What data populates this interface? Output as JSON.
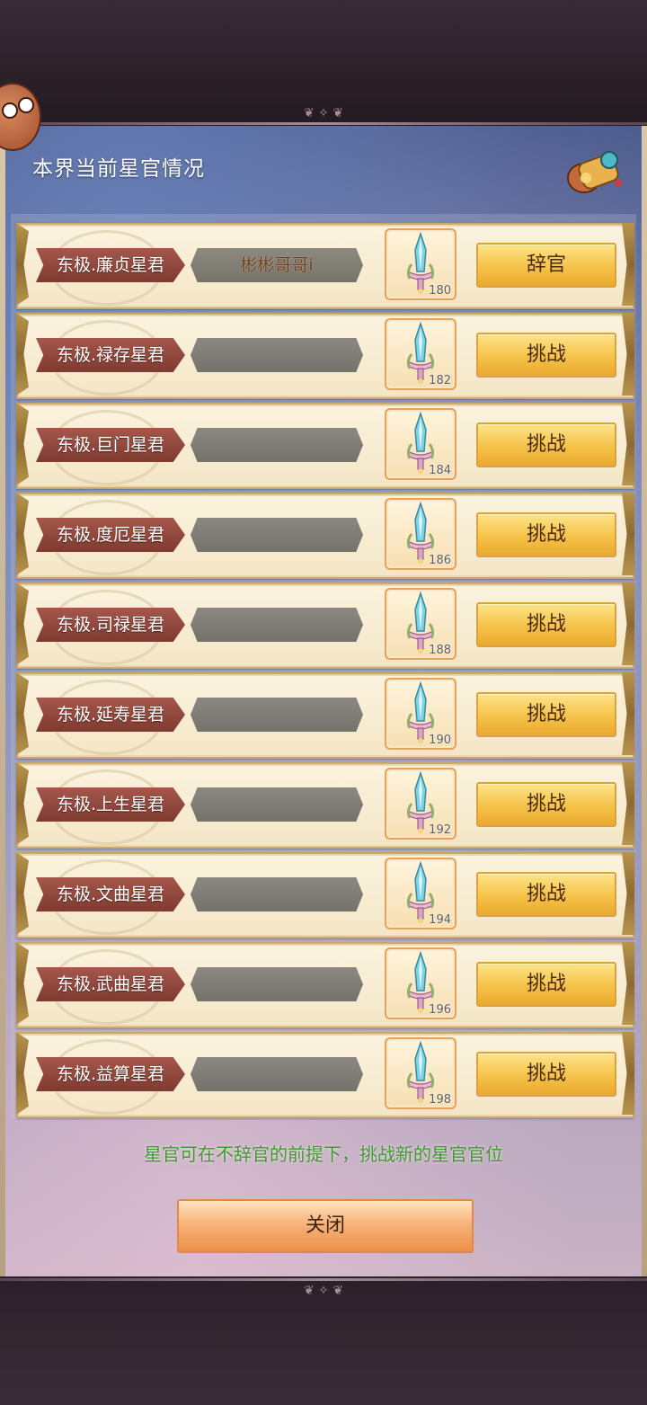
{
  "panel": {
    "title": "本界当前星官情况",
    "hint": "星官可在不辞官的前提下，挑战新的星官官位",
    "close_label": "关闭"
  },
  "rows": [
    {
      "rank": "东极.廉贞星君",
      "holder": "彬彬哥哥i",
      "item_level": "180",
      "action": "辞官"
    },
    {
      "rank": "东极.禄存星君",
      "holder": "",
      "item_level": "182",
      "action": "挑战"
    },
    {
      "rank": "东极.巨门星君",
      "holder": "",
      "item_level": "184",
      "action": "挑战"
    },
    {
      "rank": "东极.度厄星君",
      "holder": "",
      "item_level": "186",
      "action": "挑战"
    },
    {
      "rank": "东极.司禄星君",
      "holder": "",
      "item_level": "188",
      "action": "挑战"
    },
    {
      "rank": "东极.延寿星君",
      "holder": "",
      "item_level": "190",
      "action": "挑战"
    },
    {
      "rank": "东极.上生星君",
      "holder": "",
      "item_level": "192",
      "action": "挑战"
    },
    {
      "rank": "东极.文曲星君",
      "holder": "",
      "item_level": "194",
      "action": "挑战"
    },
    {
      "rank": "东极.武曲星君",
      "holder": "",
      "item_level": "196",
      "action": "挑战"
    },
    {
      "rank": "东极.益算星君",
      "holder": "",
      "item_level": "198",
      "action": "挑战"
    }
  ],
  "icons": {
    "mascot": "mascot-face-icon",
    "scroll": "treasure-scroll-icon",
    "item": "sword-icon"
  },
  "colors": {
    "hint": "#3f9a2e",
    "action_button": "#f6c248",
    "close_button": "#ee8f4a",
    "rank_ribbon": "#a5574a"
  }
}
